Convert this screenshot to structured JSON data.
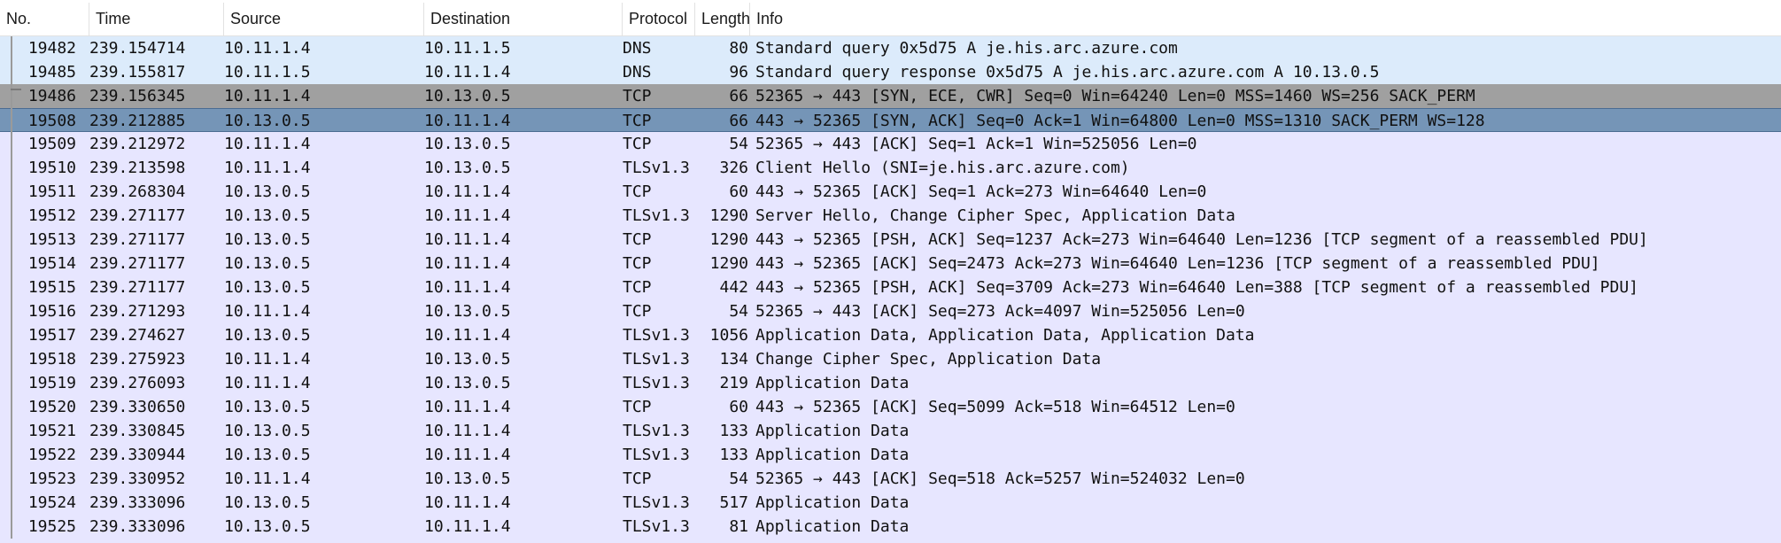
{
  "columns": [
    "No.",
    "Time",
    "Source",
    "Destination",
    "Protocol",
    "Length",
    "Info"
  ],
  "packets": [
    {
      "no": "19482",
      "time": "239.154714",
      "src": "10.11.1.4",
      "dst": "10.11.1.5",
      "proto": "DNS",
      "len": "80",
      "info": "Standard query 0x5d75 A je.his.arc.azure.com",
      "style": "dns"
    },
    {
      "no": "19485",
      "time": "239.155817",
      "src": "10.11.1.5",
      "dst": "10.11.1.4",
      "proto": "DNS",
      "len": "96",
      "info": "Standard query response 0x5d75 A je.his.arc.azure.com A 10.13.0.5",
      "style": "dns"
    },
    {
      "no": "19486",
      "time": "239.156345",
      "src": "10.11.1.4",
      "dst": "10.13.0.5",
      "proto": "TCP",
      "len": "66",
      "info": "52365 → 443 [SYN, ECE, CWR] Seq=0 Win=64240 Len=0 MSS=1460 WS=256 SACK_PERM",
      "style": "tcp-syn"
    },
    {
      "no": "19508",
      "time": "239.212885",
      "src": "10.13.0.5",
      "dst": "10.11.1.4",
      "proto": "TCP",
      "len": "66",
      "info": "443 → 52365 [SYN, ACK] Seq=0 Ack=1 Win=64800 Len=0 MSS=1310 SACK_PERM WS=128",
      "style": "sel"
    },
    {
      "no": "19509",
      "time": "239.212972",
      "src": "10.11.1.4",
      "dst": "10.13.0.5",
      "proto": "TCP",
      "len": "54",
      "info": "52365 → 443 [ACK] Seq=1 Ack=1 Win=525056 Len=0",
      "style": "norm"
    },
    {
      "no": "19510",
      "time": "239.213598",
      "src": "10.11.1.4",
      "dst": "10.13.0.5",
      "proto": "TLSv1.3",
      "len": "326",
      "info": "Client Hello (SNI=je.his.arc.azure.com)",
      "style": "norm"
    },
    {
      "no": "19511",
      "time": "239.268304",
      "src": "10.13.0.5",
      "dst": "10.11.1.4",
      "proto": "TCP",
      "len": "60",
      "info": "443 → 52365 [ACK] Seq=1 Ack=273 Win=64640 Len=0",
      "style": "norm"
    },
    {
      "no": "19512",
      "time": "239.271177",
      "src": "10.13.0.5",
      "dst": "10.11.1.4",
      "proto": "TLSv1.3",
      "len": "1290",
      "info": "Server Hello, Change Cipher Spec, Application Data",
      "style": "norm"
    },
    {
      "no": "19513",
      "time": "239.271177",
      "src": "10.13.0.5",
      "dst": "10.11.1.4",
      "proto": "TCP",
      "len": "1290",
      "info": "443 → 52365 [PSH, ACK] Seq=1237 Ack=273 Win=64640 Len=1236 [TCP segment of a reassembled PDU]",
      "style": "norm"
    },
    {
      "no": "19514",
      "time": "239.271177",
      "src": "10.13.0.5",
      "dst": "10.11.1.4",
      "proto": "TCP",
      "len": "1290",
      "info": "443 → 52365 [ACK] Seq=2473 Ack=273 Win=64640 Len=1236 [TCP segment of a reassembled PDU]",
      "style": "norm"
    },
    {
      "no": "19515",
      "time": "239.271177",
      "src": "10.13.0.5",
      "dst": "10.11.1.4",
      "proto": "TCP",
      "len": "442",
      "info": "443 → 52365 [PSH, ACK] Seq=3709 Ack=273 Win=64640 Len=388 [TCP segment of a reassembled PDU]",
      "style": "norm"
    },
    {
      "no": "19516",
      "time": "239.271293",
      "src": "10.11.1.4",
      "dst": "10.13.0.5",
      "proto": "TCP",
      "len": "54",
      "info": "52365 → 443 [ACK] Seq=273 Ack=4097 Win=525056 Len=0",
      "style": "norm"
    },
    {
      "no": "19517",
      "time": "239.274627",
      "src": "10.13.0.5",
      "dst": "10.11.1.4",
      "proto": "TLSv1.3",
      "len": "1056",
      "info": "Application Data, Application Data, Application Data",
      "style": "norm"
    },
    {
      "no": "19518",
      "time": "239.275923",
      "src": "10.11.1.4",
      "dst": "10.13.0.5",
      "proto": "TLSv1.3",
      "len": "134",
      "info": "Change Cipher Spec, Application Data",
      "style": "norm"
    },
    {
      "no": "19519",
      "time": "239.276093",
      "src": "10.11.1.4",
      "dst": "10.13.0.5",
      "proto": "TLSv1.3",
      "len": "219",
      "info": "Application Data",
      "style": "norm"
    },
    {
      "no": "19520",
      "time": "239.330650",
      "src": "10.13.0.5",
      "dst": "10.11.1.4",
      "proto": "TCP",
      "len": "60",
      "info": "443 → 52365 [ACK] Seq=5099 Ack=518 Win=64512 Len=0",
      "style": "norm"
    },
    {
      "no": "19521",
      "time": "239.330845",
      "src": "10.13.0.5",
      "dst": "10.11.1.4",
      "proto": "TLSv1.3",
      "len": "133",
      "info": "Application Data",
      "style": "norm"
    },
    {
      "no": "19522",
      "time": "239.330944",
      "src": "10.13.0.5",
      "dst": "10.11.1.4",
      "proto": "TLSv1.3",
      "len": "133",
      "info": "Application Data",
      "style": "norm"
    },
    {
      "no": "19523",
      "time": "239.330952",
      "src": "10.11.1.4",
      "dst": "10.13.0.5",
      "proto": "TCP",
      "len": "54",
      "info": "52365 → 443 [ACK] Seq=518 Ack=5257 Win=524032 Len=0",
      "style": "norm"
    },
    {
      "no": "19524",
      "time": "239.333096",
      "src": "10.13.0.5",
      "dst": "10.11.1.4",
      "proto": "TLSv1.3",
      "len": "517",
      "info": "Application Data",
      "style": "norm"
    },
    {
      "no": "19525",
      "time": "239.333096",
      "src": "10.13.0.5",
      "dst": "10.11.1.4",
      "proto": "TLSv1.3",
      "len": "81",
      "info": "Application Data",
      "style": "norm"
    }
  ],
  "colors": {
    "dns_row": "#dcebfb",
    "syn_row": "#a0a0a0",
    "selected_row": "#7595b7",
    "tcp_tls_row": "#e7e6ff"
  }
}
